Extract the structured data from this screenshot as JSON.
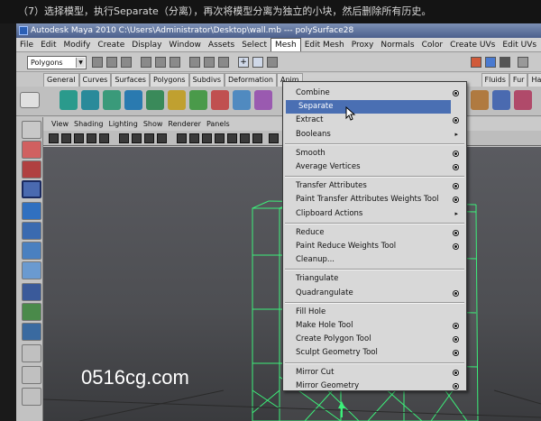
{
  "caption": "（7）选择模型，执行Separate（分离），再次将模型分离为独立的小块，然后删除所有历史。",
  "window": {
    "title": "Autodesk Maya 2010  C:\\Users\\Administrator\\Desktop\\wall.mb   ---  polySurface28"
  },
  "menubar": {
    "items": [
      "File",
      "Edit",
      "Modify",
      "Create",
      "Display",
      "Window",
      "Assets",
      "Select",
      "Mesh",
      "Edit Mesh",
      "Proxy",
      "Normals",
      "Color",
      "Create UVs",
      "Edit UVs"
    ],
    "active": "Mesh"
  },
  "statusline": {
    "mode": "Polygons"
  },
  "shelf": {
    "tabs": [
      "General",
      "Curves",
      "Surfaces",
      "Polygons",
      "Subdivs",
      "Deformation",
      "Anim"
    ],
    "tabs_right": [
      "Fluids",
      "Fur",
      "Hair"
    ]
  },
  "panel_menu": {
    "items": [
      "View",
      "Shading",
      "Lighting",
      "Show",
      "Renderer",
      "Panels"
    ]
  },
  "mesh_menu": {
    "items": [
      {
        "label": "Combine",
        "option": true,
        "submenu": false
      },
      {
        "label": "Separate",
        "option": false,
        "submenu": false,
        "highlighted": true
      },
      {
        "label": "Extract",
        "option": true,
        "submenu": false
      },
      {
        "label": "Booleans",
        "option": false,
        "submenu": true
      },
      {
        "label": "Smooth",
        "option": true,
        "submenu": false,
        "group_start": true
      },
      {
        "label": "Average Vertices",
        "option": true,
        "submenu": false
      },
      {
        "label": "Transfer Attributes",
        "option": true,
        "submenu": false,
        "group_start": true
      },
      {
        "label": "Paint Transfer Attributes Weights Tool",
        "option": true,
        "submenu": false
      },
      {
        "label": "Clipboard Actions",
        "option": false,
        "submenu": true
      },
      {
        "label": "Reduce",
        "option": true,
        "submenu": false,
        "group_start": true
      },
      {
        "label": "Paint Reduce Weights Tool",
        "option": true,
        "submenu": false
      },
      {
        "label": "Cleanup...",
        "option": false,
        "submenu": false
      },
      {
        "label": "Triangulate",
        "option": false,
        "submenu": false,
        "group_start": true
      },
      {
        "label": "Quadrangulate",
        "option": true,
        "submenu": false
      },
      {
        "label": "Fill Hole",
        "option": false,
        "submenu": false,
        "group_start": true
      },
      {
        "label": "Make Hole Tool",
        "option": true,
        "submenu": false
      },
      {
        "label": "Create Polygon Tool",
        "option": true,
        "submenu": false
      },
      {
        "label": "Sculpt Geometry Tool",
        "option": true,
        "submenu": false
      },
      {
        "label": "Mirror Cut",
        "option": true,
        "submenu": false,
        "group_start": true
      },
      {
        "label": "Mirror Geometry",
        "option": true,
        "submenu": false
      }
    ]
  },
  "watermark": "0516cg.com",
  "colors": {
    "menu_bg": "#d8d8d8",
    "highlight": "#4a6fb3",
    "wireframe": "#3cf07a",
    "viewport_bg": "#505155",
    "title_bar": "#4b5f8c"
  }
}
